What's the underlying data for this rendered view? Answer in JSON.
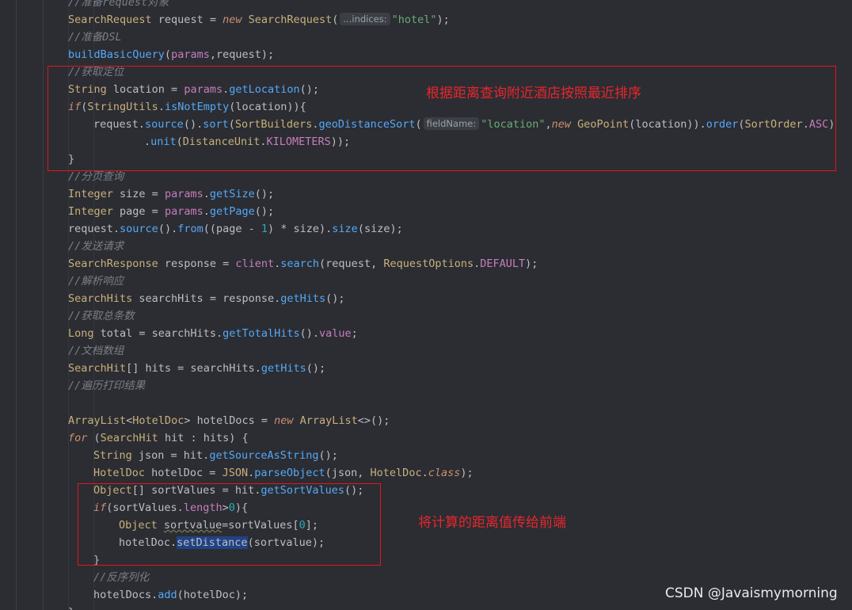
{
  "editor": {
    "lines": [
      {
        "indent": 0,
        "tokens": [
          [
            "c",
            "//准备request对象"
          ]
        ]
      },
      {
        "indent": 0,
        "tokens": [
          [
            "t",
            "SearchRequest"
          ],
          [
            "p",
            " request = "
          ],
          [
            "k",
            "new "
          ],
          [
            "t",
            "SearchRequest"
          ],
          [
            "p",
            "("
          ],
          [
            "hint",
            "...indices:"
          ],
          [
            "s",
            "\"hotel\""
          ],
          [
            "p",
            ");"
          ]
        ]
      },
      {
        "indent": 0,
        "tokens": [
          [
            "c",
            "//准备DSL"
          ]
        ]
      },
      {
        "indent": 0,
        "tokens": [
          [
            "m",
            "buildBasicQuery"
          ],
          [
            "p",
            "("
          ],
          [
            "f",
            "params"
          ],
          [
            "p",
            ",request);"
          ]
        ]
      },
      {
        "indent": 0,
        "tokens": [
          [
            "c",
            "//获取定位"
          ]
        ]
      },
      {
        "indent": 0,
        "tokens": [
          [
            "t",
            "String"
          ],
          [
            "p",
            " location = "
          ],
          [
            "f",
            "params"
          ],
          [
            "p",
            "."
          ],
          [
            "m",
            "getLocation"
          ],
          [
            "p",
            "();"
          ]
        ]
      },
      {
        "indent": 0,
        "tokens": [
          [
            "k",
            "if"
          ],
          [
            "p",
            "("
          ],
          [
            "t",
            "StringUtils"
          ],
          [
            "p",
            "."
          ],
          [
            "m",
            "isNotEmpty"
          ],
          [
            "p",
            "(location)){"
          ]
        ]
      },
      {
        "indent": 1,
        "tokens": [
          [
            "p",
            "request."
          ],
          [
            "m",
            "source"
          ],
          [
            "p",
            "()."
          ],
          [
            "m",
            "sort"
          ],
          [
            "p",
            "("
          ],
          [
            "t",
            "SortBuilders"
          ],
          [
            "p",
            "."
          ],
          [
            "m",
            "geoDistanceSort"
          ],
          [
            "p",
            "("
          ],
          [
            "hint",
            "fieldName:"
          ],
          [
            "s",
            "\"location\""
          ],
          [
            "p",
            ","
          ],
          [
            "k",
            "new "
          ],
          [
            "t",
            "GeoPoint"
          ],
          [
            "p",
            "(location))."
          ],
          [
            "m",
            "order"
          ],
          [
            "p",
            "("
          ],
          [
            "t",
            "SortOrder"
          ],
          [
            "p",
            "."
          ],
          [
            "f",
            "ASC"
          ],
          [
            "p",
            ")"
          ]
        ]
      },
      {
        "indent": 3,
        "tokens": [
          [
            "p",
            "."
          ],
          [
            "m",
            "unit"
          ],
          [
            "p",
            "("
          ],
          [
            "t",
            "DistanceUnit"
          ],
          [
            "p",
            "."
          ],
          [
            "f",
            "KILOMETERS"
          ],
          [
            "p",
            "));"
          ]
        ]
      },
      {
        "indent": 0,
        "tokens": [
          [
            "p",
            "}"
          ]
        ]
      },
      {
        "indent": 0,
        "tokens": [
          [
            "c",
            "//分页查询"
          ]
        ]
      },
      {
        "indent": 0,
        "tokens": [
          [
            "t",
            "Integer"
          ],
          [
            "p",
            " size = "
          ],
          [
            "f",
            "params"
          ],
          [
            "p",
            "."
          ],
          [
            "m",
            "getSize"
          ],
          [
            "p",
            "();"
          ]
        ]
      },
      {
        "indent": 0,
        "tokens": [
          [
            "t",
            "Integer"
          ],
          [
            "p",
            " page = "
          ],
          [
            "f",
            "params"
          ],
          [
            "p",
            "."
          ],
          [
            "m",
            "getPage"
          ],
          [
            "p",
            "();"
          ]
        ]
      },
      {
        "indent": 0,
        "tokens": [
          [
            "p",
            "request."
          ],
          [
            "m",
            "source"
          ],
          [
            "p",
            "()."
          ],
          [
            "m",
            "from"
          ],
          [
            "p",
            "((page - "
          ],
          [
            "n",
            "1"
          ],
          [
            "p",
            ") * size)."
          ],
          [
            "m",
            "size"
          ],
          [
            "p",
            "(size);"
          ]
        ]
      },
      {
        "indent": 0,
        "tokens": [
          [
            "c",
            "//发送请求"
          ]
        ]
      },
      {
        "indent": 0,
        "tokens": [
          [
            "t",
            "SearchResponse"
          ],
          [
            "p",
            " response = "
          ],
          [
            "f",
            "client"
          ],
          [
            "p",
            "."
          ],
          [
            "m",
            "search"
          ],
          [
            "p",
            "(request, "
          ],
          [
            "t",
            "RequestOptions"
          ],
          [
            "p",
            "."
          ],
          [
            "f",
            "DEFAULT"
          ],
          [
            "p",
            ");"
          ]
        ]
      },
      {
        "indent": 0,
        "tokens": [
          [
            "c",
            "//解析响应"
          ]
        ]
      },
      {
        "indent": 0,
        "tokens": [
          [
            "t",
            "SearchHits"
          ],
          [
            "p",
            " searchHits = response."
          ],
          [
            "m",
            "getHits"
          ],
          [
            "p",
            "();"
          ]
        ]
      },
      {
        "indent": 0,
        "tokens": [
          [
            "c",
            "//获取总条数"
          ]
        ]
      },
      {
        "indent": 0,
        "tokens": [
          [
            "t",
            "Long"
          ],
          [
            "p",
            " total = searchHits."
          ],
          [
            "m",
            "getTotalHits"
          ],
          [
            "p",
            "()."
          ],
          [
            "f",
            "value"
          ],
          [
            "p",
            ";"
          ]
        ]
      },
      {
        "indent": 0,
        "tokens": [
          [
            "c",
            "//文档数组"
          ]
        ]
      },
      {
        "indent": 0,
        "tokens": [
          [
            "t",
            "SearchHit"
          ],
          [
            "p",
            "[] hits = searchHits."
          ],
          [
            "m",
            "getHits"
          ],
          [
            "p",
            "();"
          ]
        ]
      },
      {
        "indent": 0,
        "tokens": [
          [
            "c",
            "//遍历打印结果"
          ]
        ]
      },
      {
        "indent": 0,
        "tokens": []
      },
      {
        "indent": 0,
        "tokens": [
          [
            "t",
            "ArrayList"
          ],
          [
            "p",
            "<"
          ],
          [
            "t",
            "HotelDoc"
          ],
          [
            "p",
            "> hotelDocs = "
          ],
          [
            "k",
            "new "
          ],
          [
            "t",
            "ArrayList"
          ],
          [
            "p",
            "<>();"
          ]
        ]
      },
      {
        "indent": 0,
        "tokens": [
          [
            "k",
            "for"
          ],
          [
            "p",
            " ("
          ],
          [
            "t",
            "SearchHit"
          ],
          [
            "p",
            " hit : hits) {"
          ]
        ]
      },
      {
        "indent": 1,
        "tokens": [
          [
            "t",
            "String"
          ],
          [
            "p",
            " json = hit."
          ],
          [
            "m",
            "getSourceAsString"
          ],
          [
            "p",
            "();"
          ]
        ]
      },
      {
        "indent": 1,
        "tokens": [
          [
            "t",
            "HotelDoc"
          ],
          [
            "p",
            " hotelDoc = "
          ],
          [
            "t",
            "JSON"
          ],
          [
            "p",
            "."
          ],
          [
            "m",
            "parseObject"
          ],
          [
            "p",
            "(json, "
          ],
          [
            "t",
            "HotelDoc"
          ],
          [
            "p",
            "."
          ],
          [
            "k",
            "class"
          ],
          [
            "p",
            ");"
          ]
        ]
      },
      {
        "indent": 1,
        "tokens": [
          [
            "t",
            "Object"
          ],
          [
            "p",
            "[] sortValues = hit."
          ],
          [
            "m",
            "getSortValues"
          ],
          [
            "p",
            "();"
          ]
        ]
      },
      {
        "indent": 1,
        "tokens": [
          [
            "k",
            "if"
          ],
          [
            "p",
            "(sortValues."
          ],
          [
            "f",
            "length"
          ],
          [
            "p",
            ">"
          ],
          [
            "n",
            "0"
          ],
          [
            "p",
            "){"
          ]
        ]
      },
      {
        "indent": 2,
        "tokens": [
          [
            "t",
            "Object"
          ],
          [
            "p",
            " "
          ],
          [
            "wavy",
            "sortvalue"
          ],
          [
            "p",
            "=sortValues["
          ],
          [
            "n",
            "0"
          ],
          [
            "p",
            "];"
          ]
        ]
      },
      {
        "indent": 2,
        "tokens": [
          [
            "p",
            "hotelDoc."
          ],
          [
            "sel",
            "setDistance"
          ],
          [
            "p",
            "(sortvalue);"
          ]
        ]
      },
      {
        "indent": 1,
        "tokens": [
          [
            "p",
            "}"
          ]
        ]
      },
      {
        "indent": 1,
        "tokens": [
          [
            "c",
            "//反序列化"
          ]
        ]
      },
      {
        "indent": 1,
        "tokens": [
          [
            "p",
            "hotelDocs."
          ],
          [
            "m",
            "add"
          ],
          [
            "p",
            "(hotelDoc);"
          ]
        ]
      },
      {
        "indent": 0,
        "tokens": [
          [
            "p",
            "}"
          ]
        ]
      }
    ]
  },
  "annotations": {
    "note1": "根据距离查询附近酒店按照最近排序",
    "note2": "将计算的距离值传给前端"
  },
  "watermark": "CSDN @Javaismymorning",
  "colors": {
    "background": "#2b2d33",
    "annotation_red": "#e2161d",
    "keyword": "#cf8e6d",
    "method": "#56a8f5",
    "string": "#6aab73",
    "comment": "#7a7e85"
  }
}
